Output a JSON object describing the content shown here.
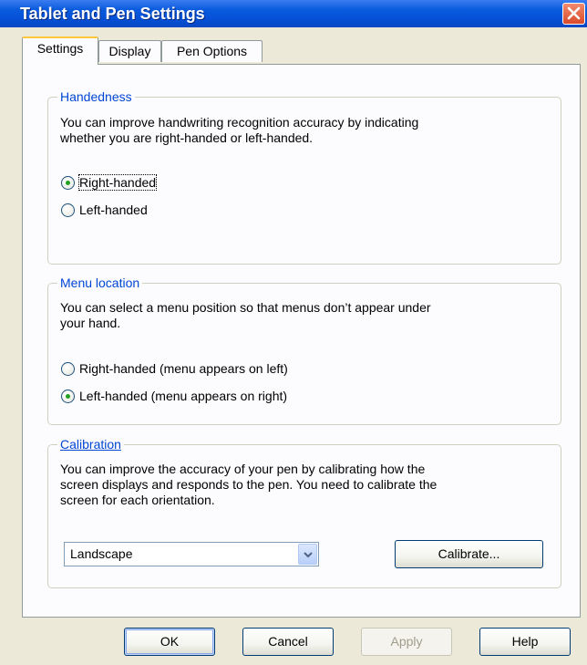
{
  "window": {
    "title": "Tablet and Pen Settings"
  },
  "tabs": [
    {
      "label": "Settings",
      "active": true
    },
    {
      "label": "Display",
      "active": false
    },
    {
      "label": "Pen Options",
      "active": false
    }
  ],
  "handedness": {
    "label": "Handedness",
    "description_line1": "You can improve handwriting recognition accuracy by indicating",
    "description_line2": "whether you are right-handed or left-handed.",
    "options": [
      {
        "label": "Right-handed",
        "selected": true
      },
      {
        "label": "Left-handed",
        "selected": false
      }
    ]
  },
  "menu_location": {
    "label": "Menu location",
    "description_line1": "You can select a menu position so that menus don’t appear under",
    "description_line2": "your hand.",
    "options": [
      {
        "label": "Right-handed (menu appears on left)",
        "selected": false
      },
      {
        "label": "Left-handed (menu appears on right)",
        "selected": true
      }
    ]
  },
  "calibration": {
    "label": "Calibration",
    "description_line1": "You can improve the accuracy of your pen by calibrating how the",
    "description_line2": "screen displays and responds to the pen. You need to calibrate the",
    "description_line3": "screen for each orientation.",
    "orientation_value": "Landscape",
    "calibrate_label": "Calibrate..."
  },
  "buttons": {
    "ok": "OK",
    "cancel": "Cancel",
    "apply": "Apply",
    "help": "Help"
  },
  "colors": {
    "title_bar": "#0a5bde",
    "group_label": "#0046d5",
    "close_button": "#d94a2a",
    "dialog_face": "#ece9d8"
  }
}
